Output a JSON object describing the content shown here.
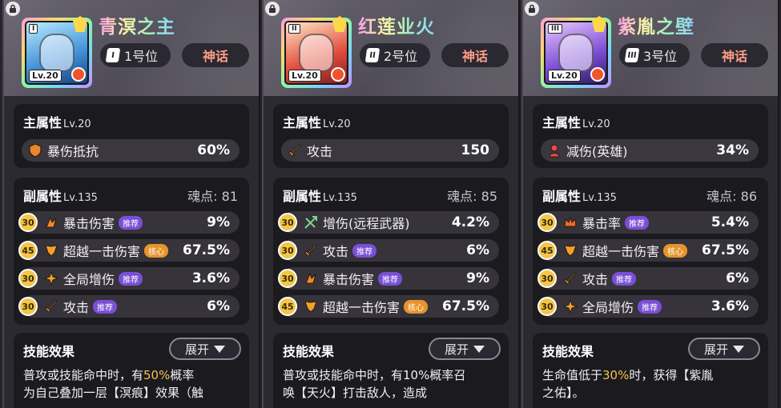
{
  "panels": [
    {
      "card_roman": "I",
      "card_level": "Lv.20",
      "name": "青溟之主",
      "position_roman": "I",
      "position_text": "1号位",
      "rarity": "神话",
      "main": {
        "title": "主属性",
        "level": "Lv.20",
        "stat": "暴伤抵抗",
        "value": "60%",
        "icon": "shield-icon"
      },
      "sub": {
        "title": "副属性",
        "level": "Lv.135",
        "soul_label": "魂点:",
        "soul_value": "81",
        "rows": [
          {
            "lvl": "30",
            "icon": "claw-icon",
            "stat": "暴击伤害",
            "tag": "推荐",
            "value": "9%"
          },
          {
            "lvl": "45",
            "icon": "wing-icon",
            "stat": "超越一击伤害",
            "tag": "核心",
            "value": "67.5%"
          },
          {
            "lvl": "30",
            "icon": "burst-icon",
            "stat": "全局增伤",
            "tag": "推荐",
            "value": "3.6%"
          },
          {
            "lvl": "30",
            "icon": "sword-icon",
            "stat": "攻击",
            "tag": "推荐",
            "value": "6%"
          }
        ]
      },
      "skill": {
        "title": "技能效果",
        "expand": "展开",
        "line1a": "普攻或技能命中时，有",
        "line1hl": "50%",
        "line1b": "概率",
        "line2": "为自己叠加一层【溟痕】效果（触"
      }
    },
    {
      "card_roman": "II",
      "card_level": "Lv.20",
      "name": "红莲业火",
      "position_roman": "II",
      "position_text": "2号位",
      "rarity": "神话",
      "main": {
        "title": "主属性",
        "level": "Lv.20",
        "stat": "攻击",
        "value": "150",
        "icon": "sword-icon"
      },
      "sub": {
        "title": "副属性",
        "level": "Lv.135",
        "soul_label": "魂点:",
        "soul_value": "85",
        "rows": [
          {
            "lvl": "30",
            "icon": "crossbow-icon",
            "stat": "增伤(远程武器)",
            "tag": "",
            "value": "4.2%"
          },
          {
            "lvl": "30",
            "icon": "sword-icon",
            "stat": "攻击",
            "tag": "推荐",
            "value": "6%"
          },
          {
            "lvl": "30",
            "icon": "claw-icon",
            "stat": "暴击伤害",
            "tag": "推荐",
            "value": "9%"
          },
          {
            "lvl": "45",
            "icon": "wing-icon",
            "stat": "超越一击伤害",
            "tag": "核心",
            "value": "67.5%"
          }
        ]
      },
      "skill": {
        "title": "技能效果",
        "expand": "展开",
        "line1a": "普攻或技能命中时，有10%概率召",
        "line1hl": "",
        "line1b": "",
        "line2": "唤【天火】打击敌人，造成"
      }
    },
    {
      "card_roman": "III",
      "card_level": "Lv.20",
      "name": "紫胤之壁",
      "position_roman": "III",
      "position_text": "3号位",
      "rarity": "神话",
      "main": {
        "title": "主属性",
        "level": "Lv.20",
        "stat": "减伤(英雄)",
        "value": "34%",
        "icon": "hero-icon"
      },
      "sub": {
        "title": "副属性",
        "level": "Lv.135",
        "soul_label": "魂点:",
        "soul_value": "86",
        "rows": [
          {
            "lvl": "30",
            "icon": "crown-icon",
            "stat": "暴击率",
            "tag": "推荐",
            "value": "5.4%"
          },
          {
            "lvl": "45",
            "icon": "wing-icon",
            "stat": "超越一击伤害",
            "tag": "核心",
            "value": "67.5%"
          },
          {
            "lvl": "30",
            "icon": "sword-icon",
            "stat": "攻击",
            "tag": "推荐",
            "value": "6%"
          },
          {
            "lvl": "30",
            "icon": "burst-icon",
            "stat": "全局增伤",
            "tag": "推荐",
            "value": "3.6%"
          }
        ]
      },
      "skill": {
        "title": "技能效果",
        "expand": "展开",
        "line1a": "生命值低于",
        "line1hl": "30%",
        "line1b": "时，获得【紫胤",
        "line2": "之佑】。"
      }
    }
  ]
}
